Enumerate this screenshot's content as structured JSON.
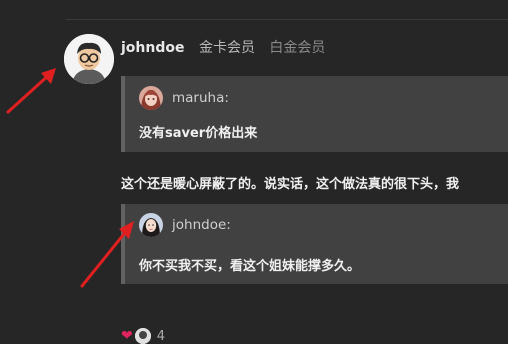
{
  "post": {
    "username": "johndoe",
    "badge_gold": "金卡会员",
    "badge_platinum": "白金会员",
    "body": "这个还是暖心屏蔽了的。说实话，这个做法真的很下头，我"
  },
  "quote1": {
    "user": "maruha:",
    "text": "没有saver价格出来"
  },
  "quote2": {
    "user": "johndoe:",
    "text": "你不买我不买，看这个姐妹能撑多久。"
  },
  "reactions": {
    "icon": "heart-icon",
    "count": "4"
  },
  "colors": {
    "background": "#262626",
    "quote_bg": "#414141",
    "arrow": "#e02020"
  }
}
